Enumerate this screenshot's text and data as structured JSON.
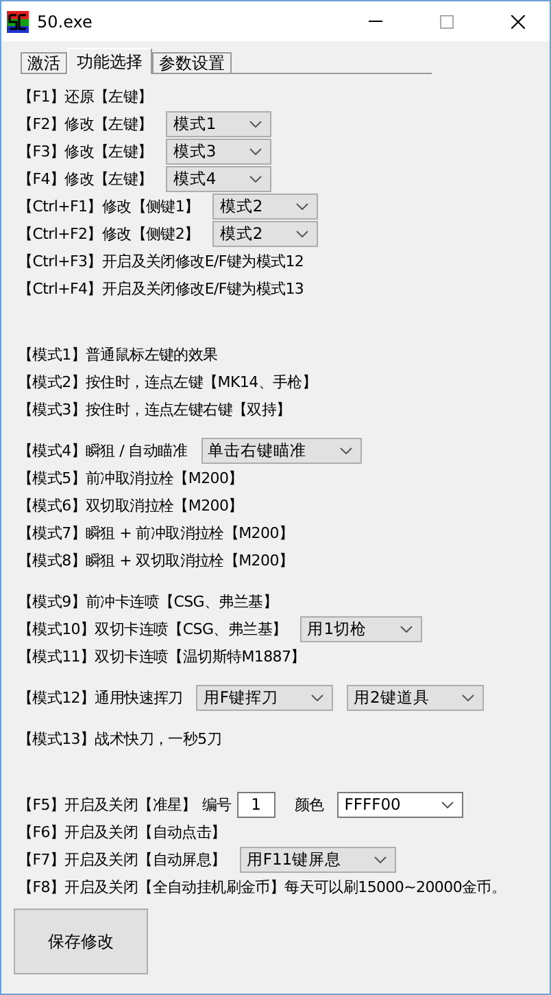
{
  "window": {
    "title": "50.exe"
  },
  "tabs": [
    {
      "label": "激活",
      "selected": false
    },
    {
      "label": "功能选择",
      "selected": true
    },
    {
      "label": "参数设置",
      "selected": false
    }
  ],
  "hotkeys": [
    {
      "items": [
        {
          "kind": "text",
          "text": "【F1】还原【左键】"
        }
      ]
    },
    {
      "items": [
        {
          "kind": "text",
          "text": "【F2】修改【左键】"
        },
        {
          "kind": "dropdown",
          "value": "模式1"
        }
      ]
    },
    {
      "items": [
        {
          "kind": "text",
          "text": "【F3】修改【左键】"
        },
        {
          "kind": "dropdown",
          "value": "模式3"
        }
      ]
    },
    {
      "items": [
        {
          "kind": "text",
          "text": "【F4】修改【左键】"
        },
        {
          "kind": "dropdown",
          "value": "模式4"
        }
      ]
    },
    {
      "items": [
        {
          "kind": "text",
          "text": "【Ctrl+F1】修改【侧键1】"
        },
        {
          "kind": "dropdown",
          "value": "模式2"
        }
      ]
    },
    {
      "items": [
        {
          "kind": "text",
          "text": "【Ctrl+F2】修改【侧键2】"
        },
        {
          "kind": "dropdown",
          "value": "模式2"
        }
      ]
    },
    {
      "items": [
        {
          "kind": "text",
          "text": "【Ctrl+F3】开启及关闭修改E/F键为模式12"
        }
      ]
    },
    {
      "items": [
        {
          "kind": "text",
          "text": "【Ctrl+F4】开启及关闭修改E/F键为模式13"
        }
      ]
    }
  ],
  "modes": [
    {
      "rows": [
        {
          "items": [
            {
              "kind": "text",
              "text": "【模式1】普通鼠标左键的效果"
            }
          ]
        },
        {
          "items": [
            {
              "kind": "text",
              "text": "【模式2】按住时，连点左键【MK14、手枪】"
            }
          ]
        },
        {
          "items": [
            {
              "kind": "text",
              "text": "【模式3】按住时，连点左键右键【双持】"
            }
          ]
        }
      ]
    },
    {
      "rows": [
        {
          "items": [
            {
              "kind": "text",
              "text": "【模式4】瞬狙 / 自动瞄准"
            },
            {
              "kind": "dropdown",
              "value": "单击右键瞄准"
            }
          ]
        },
        {
          "items": [
            {
              "kind": "text",
              "text": "【模式5】前冲取消拉栓【M200】"
            }
          ]
        },
        {
          "items": [
            {
              "kind": "text",
              "text": "【模式6】双切取消拉栓【M200】"
            }
          ]
        },
        {
          "items": [
            {
              "kind": "text",
              "text": "【模式7】瞬狙 + 前冲取消拉栓【M200】"
            }
          ]
        },
        {
          "items": [
            {
              "kind": "text",
              "text": "【模式8】瞬狙 + 双切取消拉栓【M200】"
            }
          ]
        }
      ]
    },
    {
      "rows": [
        {
          "items": [
            {
              "kind": "text",
              "text": "【模式9】前冲卡连喷【CSG、弗兰基】"
            }
          ]
        },
        {
          "items": [
            {
              "kind": "text",
              "text": "【模式10】双切卡连喷【CSG、弗兰基】"
            },
            {
              "kind": "dropdown",
              "value": "用1切枪"
            }
          ]
        },
        {
          "items": [
            {
              "kind": "text",
              "text": "【模式11】双切卡连喷【温切斯特M1887】"
            }
          ]
        }
      ]
    },
    {
      "rows": [
        {
          "items": [
            {
              "kind": "text",
              "text": "【模式12】通用快速挥刀"
            },
            {
              "kind": "dropdown",
              "value": "用F键挥刀"
            },
            {
              "kind": "dropdown",
              "value": "用2键道具"
            }
          ]
        }
      ]
    },
    {
      "rows": [
        {
          "items": [
            {
              "kind": "text",
              "text": "【模式13】战术快刀，一秒5刀"
            }
          ]
        }
      ]
    }
  ],
  "toggles": [
    {
      "items": [
        {
          "kind": "text",
          "text": "【F5】开启及关闭【准星】"
        },
        {
          "kind": "text",
          "text": "编号"
        },
        {
          "kind": "input",
          "value": "1"
        },
        {
          "kind": "text",
          "text": "颜色"
        },
        {
          "kind": "combo",
          "value": "FFFF00"
        }
      ]
    },
    {
      "items": [
        {
          "kind": "text",
          "text": "【F6】开启及关闭【自动点击】"
        }
      ]
    },
    {
      "items": [
        {
          "kind": "text",
          "text": "【F7】开启及关闭【自动屏息】"
        },
        {
          "kind": "dropdown",
          "value": "用F11键屏息"
        }
      ]
    },
    {
      "items": [
        {
          "kind": "text",
          "text": "【F8】开启及关闭【全自动挂机刷金币】每天可以刷15000~20000金币。"
        }
      ]
    }
  ],
  "save_button": "保存修改"
}
